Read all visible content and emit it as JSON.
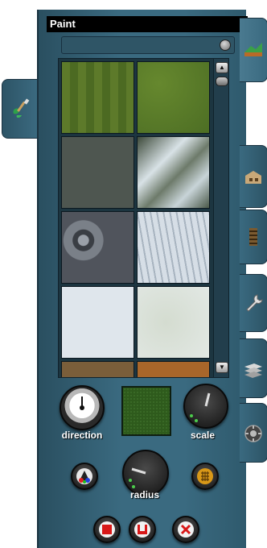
{
  "panel": {
    "title": "Paint",
    "knobs": {
      "direction_label": "direction",
      "scale_label": "scale",
      "radius_label": "radius"
    }
  },
  "swatches": [
    {
      "name": "striped-grass",
      "color": "#5d7a2a"
    },
    {
      "name": "grass",
      "color": "#56782a"
    },
    {
      "name": "dark-gravel",
      "color": "#4e5650"
    },
    {
      "name": "stream-rocks",
      "color": "#6c7a72"
    },
    {
      "name": "granite",
      "color": "#6a6e76"
    },
    {
      "name": "snow-streaks",
      "color": "#c8d2da"
    },
    {
      "name": "snow",
      "color": "#dfe6ec"
    },
    {
      "name": "snow-grass",
      "color": "#d4dcd0"
    },
    {
      "name": "dirt",
      "color": "#7a5e3a"
    },
    {
      "name": "orange-dirt",
      "color": "#a8662a"
    }
  ],
  "icons": {
    "left_tab": "paint-brush-icon",
    "right_tabs": [
      "terrain-icon",
      "building-icon",
      "track-icon",
      "wrench-icon",
      "layers-icon",
      "settings-icon"
    ],
    "bottom_buttons": [
      "stop-icon",
      "fill-icon",
      "close-icon"
    ],
    "tool_buttons": [
      "color-picker-icon",
      "grid-icon"
    ]
  }
}
